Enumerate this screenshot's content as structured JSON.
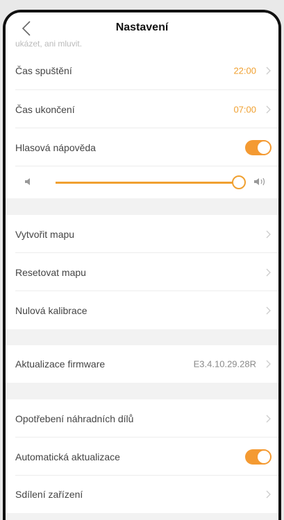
{
  "header": {
    "title": "Nastavení",
    "back_icon": "chevron-left-icon"
  },
  "clipped_text": "ukázet, ani mluvit.",
  "rows": {
    "start_time": {
      "label": "Čas spuštění",
      "value": "22:00"
    },
    "end_time": {
      "label": "Čas ukončení",
      "value": "07:00"
    },
    "voice_prompt": {
      "label": "Hlasová nápověda",
      "enabled": true
    },
    "create_map": {
      "label": "Vytvořit mapu"
    },
    "reset_map": {
      "label": "Resetovat mapu"
    },
    "zero_calibration": {
      "label": "Nulová kalibrace"
    },
    "firmware": {
      "label": "Aktualizace firmware",
      "value": "E3.4.10.29.28R"
    },
    "parts_wear": {
      "label": "Opotřebení náhradních dílů"
    },
    "auto_update": {
      "label": "Automatická aktualizace",
      "enabled": true
    },
    "share_device": {
      "label": "Sdílení zařízení"
    }
  },
  "volume": {
    "level_percent": 100,
    "low_icon": "volume-low-icon",
    "high_icon": "volume-high-icon"
  },
  "colors": {
    "accent": "#f0a030",
    "toggle_on": "#f49a32",
    "background": "#f2f2f2"
  }
}
